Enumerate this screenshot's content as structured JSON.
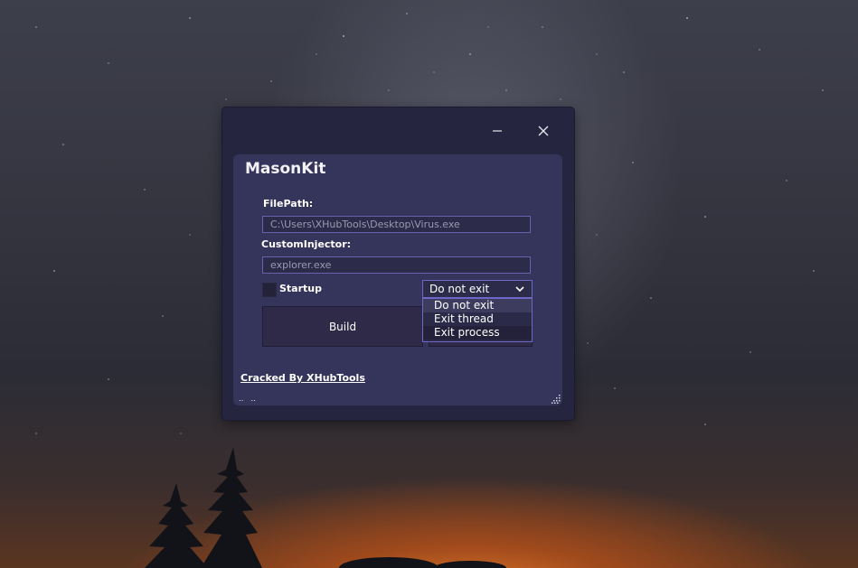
{
  "app": {
    "title": "MasonKit"
  },
  "window_controls": {
    "minimize_icon": "minimize-icon",
    "close_icon": "close-icon"
  },
  "form": {
    "filepath_label": "FilePath:",
    "filepath_value": "C:\\Users\\XHubTools\\Desktop\\Virus.exe",
    "injector_label": "CustomInjector:",
    "injector_placeholder": "explorer.exe",
    "startup_label": "Startup",
    "startup_checked": false,
    "exit_select": {
      "selected": "Do not exit",
      "options": [
        "Do not exit",
        "Exit thread",
        "Exit process"
      ]
    },
    "build_label": "Build"
  },
  "footer": {
    "credit": "Cracked By XHubTools"
  },
  "colors": {
    "window_bg": "#262540",
    "panel_bg": "#35345a",
    "accent_border": "#6f66c9",
    "text": "#ffffff"
  }
}
